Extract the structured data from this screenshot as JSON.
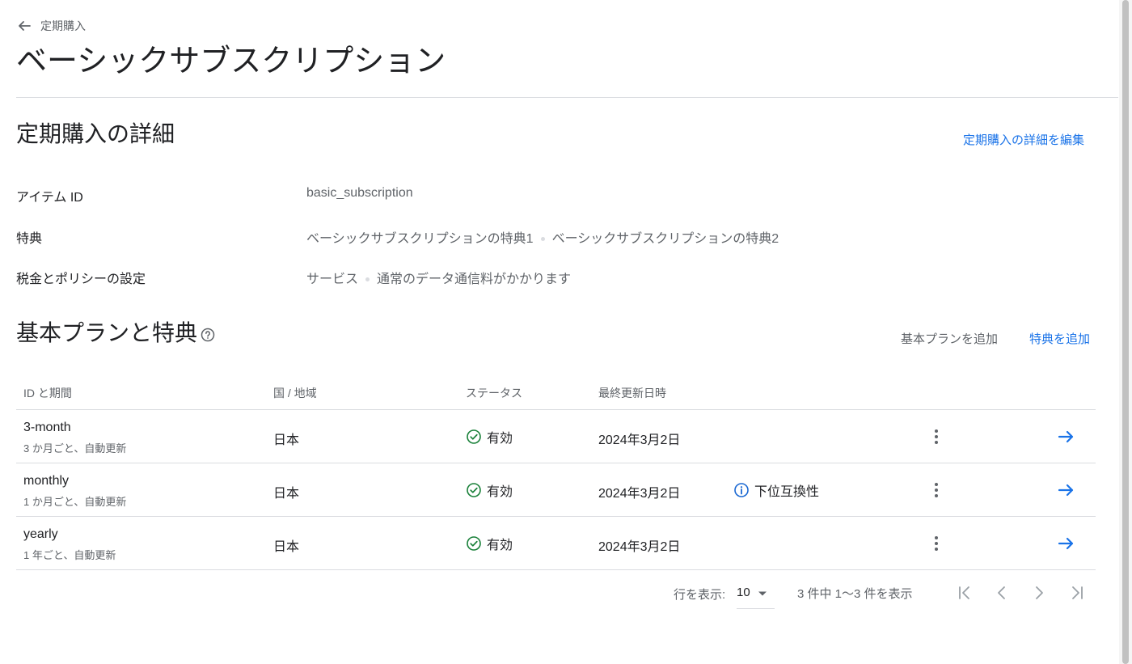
{
  "breadcrumb": {
    "back_label": "定期購入"
  },
  "page_title": "ベーシックサブスクリプション",
  "details": {
    "title": "定期購入の詳細",
    "edit_link": "定期購入の詳細を編集",
    "rows": [
      {
        "label": "アイテム ID",
        "values": [
          "basic_subscription"
        ]
      },
      {
        "label": "特典",
        "values": [
          "ベーシックサブスクリプションの特典1",
          "ベーシックサブスクリプションの特典2"
        ]
      },
      {
        "label": "税金とポリシーの設定",
        "values": [
          "サービス",
          "通常のデータ通信料がかかります"
        ]
      }
    ]
  },
  "plans": {
    "title": "基本プランと特典",
    "add_plan": "基本プランを追加",
    "add_offer": "特典を追加",
    "columns": [
      "ID と期間",
      "国 / 地域",
      "ステータス",
      "最終更新日時"
    ],
    "rows": [
      {
        "id": "3-month",
        "period": "3 か月ごと、自動更新",
        "region": "日本",
        "status": "有効",
        "updated": "2024年3月2日",
        "note": ""
      },
      {
        "id": "monthly",
        "period": "1 か月ごと、自動更新",
        "region": "日本",
        "status": "有効",
        "updated": "2024年3月2日",
        "note": "下位互換性"
      },
      {
        "id": "yearly",
        "period": "1 年ごと、自動更新",
        "region": "日本",
        "status": "有効",
        "updated": "2024年3月2日",
        "note": ""
      }
    ]
  },
  "pagination": {
    "rows_label": "行を表示:",
    "rows_per_page": "10",
    "range_text": "3 件中 1〜3 件を表示"
  },
  "colors": {
    "link": "#1a73e8",
    "success": "#188038",
    "info": "#1967d2",
    "muted": "#5f6368"
  },
  "icons": {
    "back": "arrow-left-icon",
    "help": "help-circle-icon",
    "status": "check-circle-icon",
    "note": "info-icon",
    "menu": "more-vert-icon",
    "open": "arrow-right-icon",
    "pager": [
      "first-page-icon",
      "chevron-left-icon",
      "chevron-right-icon",
      "last-page-icon"
    ]
  }
}
